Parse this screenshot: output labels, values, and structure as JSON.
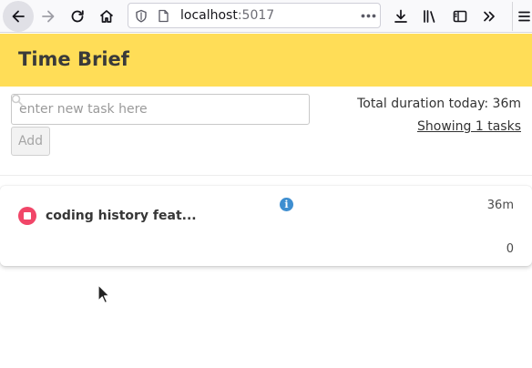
{
  "browser": {
    "url_host": "localhost",
    "url_port": ":5017"
  },
  "app": {
    "title": "Time Brief"
  },
  "controls": {
    "task_input_placeholder": "enter new task here",
    "task_input_value": "",
    "add_label": "Add",
    "total_duration": "Total duration today: 36m",
    "showing_tasks": "Showing 1 tasks"
  },
  "tasks": [
    {
      "name": "coding history feat...",
      "duration": "36m",
      "count": "0"
    }
  ],
  "colors": {
    "header": "#ffdd57",
    "stop": "#f14668",
    "info": "#3e8ed0"
  }
}
